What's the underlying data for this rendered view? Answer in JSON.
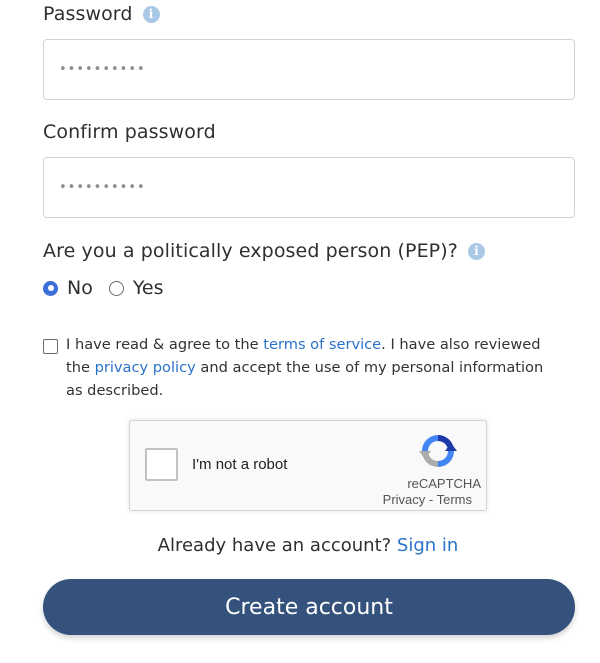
{
  "password": {
    "label": "Password",
    "value": "••••••••••"
  },
  "confirm_password": {
    "label": "Confirm password",
    "value": "••••••••••"
  },
  "pep": {
    "question": "Are you a politically exposed person (PEP)?",
    "options": [
      {
        "label": "No",
        "selected": true
      },
      {
        "label": "Yes",
        "selected": false
      }
    ]
  },
  "terms": {
    "text_1": "I have read & agree to the ",
    "terms_link": "terms of service",
    "text_2": ". I have also reviewed the ",
    "privacy_link": "privacy policy",
    "text_3": " and accept the use of my personal information as described."
  },
  "captcha": {
    "label": "I'm not a robot",
    "brand": "reCAPTCHA",
    "privacy": "Privacy",
    "separator": " - ",
    "terms": "Terms"
  },
  "signin": {
    "prompt": "Already have an account? ",
    "link": "Sign in"
  },
  "create_button": {
    "label": "Create account"
  },
  "colors": {
    "primary_button": "#34527b",
    "link": "#2b72c9",
    "radio_selected": "#3d6fd9",
    "info_icon": "#a9c8e6"
  },
  "icons": {
    "info": "info-icon",
    "recaptcha": "recaptcha-logo-icon"
  }
}
